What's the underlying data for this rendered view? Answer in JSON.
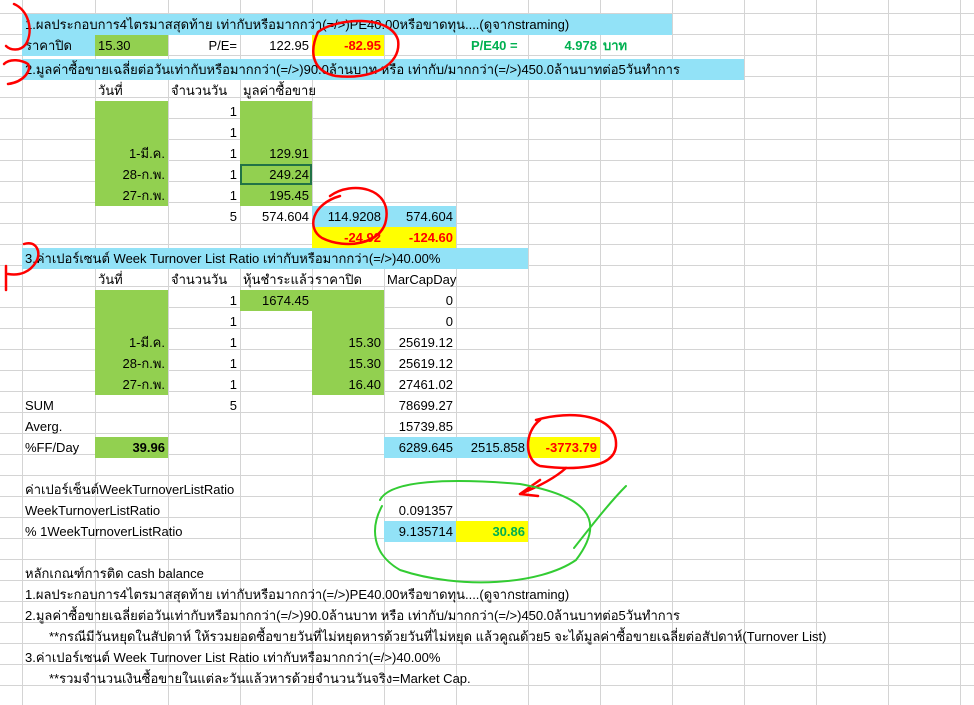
{
  "sec1": {
    "title": "1.ผลประกอบการ4ไตรมาสสุดท้าย เท่ากับหรือมากกว่า(=/>)PE40.00หรือขาดทุน....(ดูจากstraming)",
    "close_label": "ราคาปิด",
    "close_value": "15.30",
    "pe_label": "P/E=",
    "pe_value": "122.95",
    "pe_diff": "-82.95",
    "pe40_label": "P/E40 =",
    "pe40_value": "4.978",
    "pe40_unit": "บาท"
  },
  "sec2": {
    "title": "2.มูลค่าซื้อขายเฉลี่ยต่อวันเท่ากับหรือมากกว่า(=/>)90.0ล้านบาท หรือ เท่ากับ/มากกว่า(=/>)450.0ล้านบาทต่อ5วันทำการ",
    "col_date": "วันที่",
    "col_days": "จำนวนวัน",
    "col_value": "มูลค่าซื้อขาย",
    "rows": [
      {
        "date": "",
        "days": "1",
        "value": ""
      },
      {
        "date": "",
        "days": "1",
        "value": ""
      },
      {
        "date": "1-มี.ค.",
        "days": "1",
        "value": "129.91"
      },
      {
        "date": "28-ก.พ.",
        "days": "1",
        "value": "249.24"
      },
      {
        "date": "27-ก.พ.",
        "days": "1",
        "value": "195.45"
      }
    ],
    "sum_days": "5",
    "sum_value": "574.604",
    "avg_value": "114.9208",
    "sum_value2": "574.604",
    "diff1": "-24.92",
    "diff2": "-124.60"
  },
  "sec3": {
    "title": "3.ค่าเปอร์เซนต์ Week Turnover List Ratio เท่ากับหรือมากกว่า(=/>)40.00%",
    "col_date": "วันที่",
    "col_days": "จำนวนวัน",
    "col_shares": "หุ้นชำระแล้ว",
    "col_close": "ราคาปิด",
    "col_mcap": "MarCapDay",
    "rows": [
      {
        "date": "",
        "days": "1",
        "shares": "1674.45",
        "close": "",
        "mcap": "0"
      },
      {
        "date": "",
        "days": "1",
        "shares": "",
        "close": "",
        "mcap": "0"
      },
      {
        "date": "1-มี.ค.",
        "days": "1",
        "shares": "",
        "close": "15.30",
        "mcap": "25619.12"
      },
      {
        "date": "28-ก.พ.",
        "days": "1",
        "shares": "",
        "close": "15.30",
        "mcap": "25619.12"
      },
      {
        "date": "27-ก.พ.",
        "days": "1",
        "shares": "",
        "close": "16.40",
        "mcap": "27461.02"
      }
    ],
    "sum_label": "SUM",
    "sum_days": "5",
    "sum_mcap": "78699.27",
    "avg_label": "Averg.",
    "avg_mcap": "15739.85",
    "ff_label": "%FF/Day",
    "ff_value": "39.96",
    "ff_v1": "6289.645",
    "ff_v2": "2515.858",
    "ff_v3": "-3773.79"
  },
  "ratio": {
    "header": "ค่าเปอร์เซ็นต์WeekTurnoverListRatio",
    "label1": "WeekTurnoverListRatio",
    "value1": "0.091357",
    "label2": "% 1WeekTurnoverListRatio",
    "value2": "9.135714",
    "target": "30.86"
  },
  "criteria": {
    "header": "หลักเกณฑ์การติด cash balance",
    "line1": "1.ผลประกอบการ4ไตรมาสสุดท้าย เท่ากับหรือมากกว่า(=/>)PE40.00หรือขาดทุน....(ดูจากstraming)",
    "line2": "2.มูลค่าซื้อขายเฉลี่ยต่อวันเท่ากับหรือมากกว่า(=/>)90.0ล้านบาท หรือ เท่ากับ/มากกว่า(=/>)450.0ล้านบาทต่อ5วันทำการ",
    "note2": "**กรณีมีวันหยุดในสัปดาห์ ให้รวมยอดซื้อขายวันที่ไม่หยุดหารด้วยวันที่ไม่หยุด แล้วคูณด้วย5 จะได้มูลค่าซื้อขายเฉลี่ยต่อสัปดาห์(Turnover List)",
    "line3": "3.ค่าเปอร์เซนต์ Week Turnover List Ratio เท่ากับหรือมากกว่า(=/>)40.00%",
    "note3": "**รวมจำนวนเงินซื้อขายในแต่ละวันแล้วหารด้วยจำนวนวันจริง=Market Cap."
  }
}
